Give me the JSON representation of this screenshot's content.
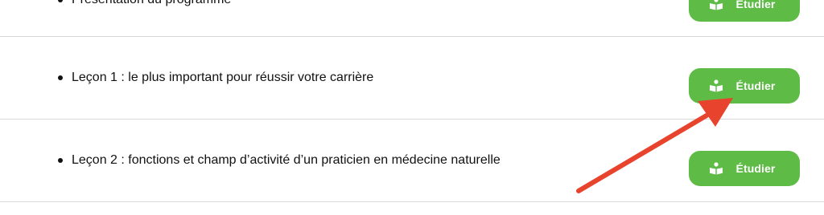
{
  "lessons": [
    {
      "title": "Présentation du programme",
      "button_label": "Étudier",
      "icon": "open-book-reader-icon"
    },
    {
      "title": "Leçon 1 : le plus important pour réussir votre carrière",
      "button_label": "Étudier",
      "icon": "open-book-reader-icon"
    },
    {
      "title": "Leçon 2 : fonctions et champ d’activité d’un praticien en médecine naturelle",
      "button_label": "Étudier",
      "icon": "open-book-reader-icon"
    }
  ],
  "colors": {
    "button_green": "#5dbb46",
    "annotation_arrow": "#e8432c",
    "divider": "#d7d7d7"
  },
  "annotation": {
    "type": "arrow",
    "points_to": "Leçon 1 Étudier button"
  }
}
